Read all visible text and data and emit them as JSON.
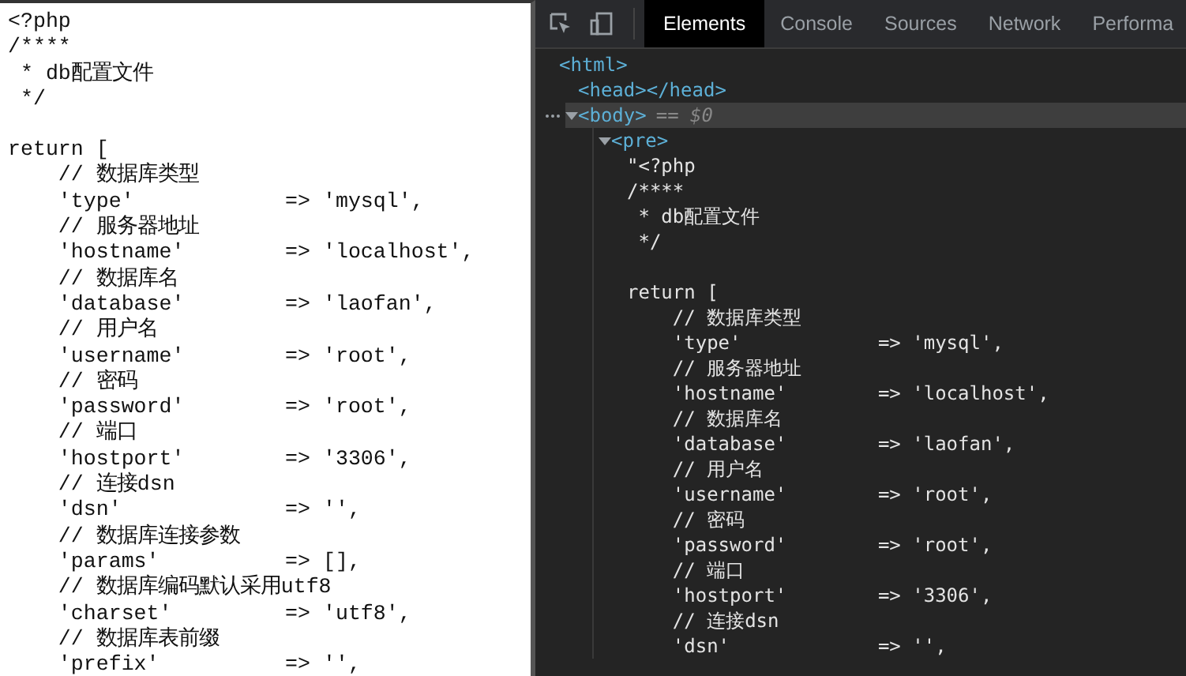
{
  "source_view": {
    "blocks": [
      [
        "<?php",
        "/****",
        " * db配置文件",
        " */"
      ],
      [
        "return [",
        "    // 数据库类型",
        "    'type'            => 'mysql',",
        "    // 服务器地址",
        "    'hostname'        => 'localhost',",
        "    // 数据库名",
        "    'database'        => 'laofan',",
        "    // 用户名",
        "    'username'        => 'root',",
        "    // 密码",
        "    'password'        => 'root',",
        "    // 端口",
        "    'hostport'        => '3306',",
        "    // 连接dsn",
        "    'dsn'             => '',",
        "    // 数据库连接参数",
        "    'params'          => [],",
        "    // 数据库编码默认采用utf8",
        "    'charset'         => 'utf8',",
        "    // 数据库表前缀",
        "    'prefix'          => '',"
      ]
    ]
  },
  "devtools": {
    "tabs": [
      {
        "label": "Elements",
        "selected": true
      },
      {
        "label": "Console",
        "selected": false
      },
      {
        "label": "Sources",
        "selected": false
      },
      {
        "label": "Network",
        "selected": false
      },
      {
        "label": "Performa",
        "selected": false
      }
    ],
    "dom_tree": [
      {
        "kind": "tag",
        "text": "<html>",
        "selected": false,
        "children": [
          {
            "kind": "tag",
            "text": "<head></head>",
            "selected": false
          },
          {
            "kind": "tag",
            "text": "<body>",
            "selected": true,
            "expanded": true,
            "marker": "== $0",
            "children": [
              {
                "kind": "tag",
                "text": "<pre>",
                "selected": false,
                "expanded": true,
                "children": [
                  {
                    "kind": "text",
                    "blocks": [
                      [
                        "\"<?php",
                        "/****",
                        " * db配置文件",
                        " */"
                      ],
                      [
                        "return [",
                        "    // 数据库类型",
                        "    'type'            => 'mysql',",
                        "    // 服务器地址",
                        "    'hostname'        => 'localhost',",
                        "    // 数据库名",
                        "    'database'        => 'laofan',",
                        "    // 用户名",
                        "    'username'        => 'root',",
                        "    // 密码",
                        "    'password'        => 'root',",
                        "    // 端口",
                        "    'hostport'        => '3306',",
                        "    // 连接dsn",
                        "    'dsn'             => '',"
                      ]
                    ]
                  }
                ]
              }
            ]
          }
        ]
      }
    ]
  }
}
